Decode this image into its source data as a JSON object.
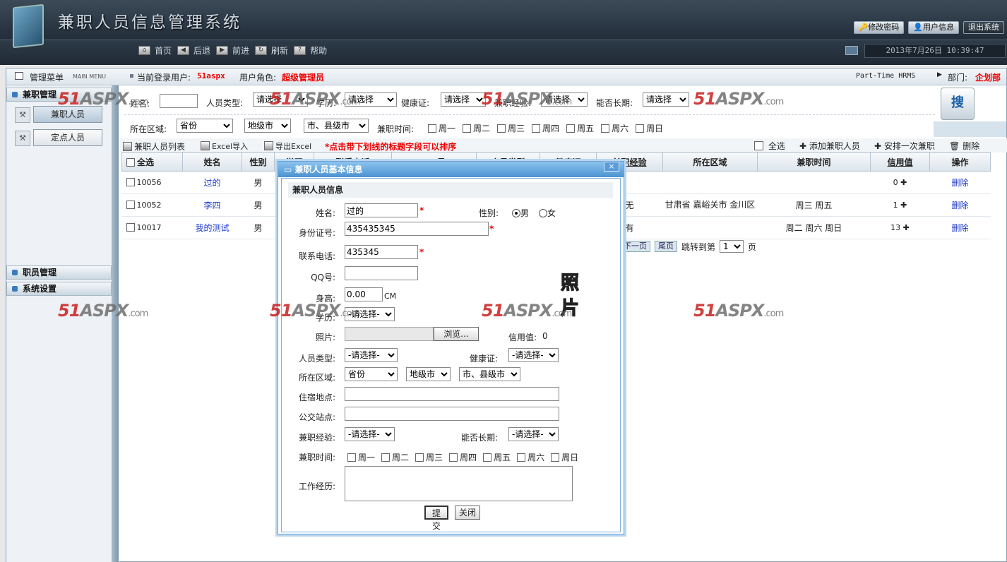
{
  "header": {
    "app_title": "兼职人员信息管理系统",
    "top_tabs": [
      "修改密码",
      "用户信息",
      "退出系统"
    ],
    "nav": [
      "首页",
      "后退",
      "前进",
      "刷新",
      "帮助"
    ],
    "datetime": "2013年7月26日 10:39:47"
  },
  "infobar": {
    "menu_title": "管理菜单",
    "menu_sub": "MAIN MENU",
    "login_label": "当前登录用户:",
    "login_user": "51aspx",
    "role_label": "用户角色:",
    "role": "超级管理员",
    "system_name": "Part-Time HRMS",
    "dept_label": "部门:",
    "dept": "企划部"
  },
  "sidebar": {
    "group1": "兼职管理",
    "items": [
      "兼职人员",
      "定点人员"
    ],
    "group2": "职员管理",
    "group3": "系统设置"
  },
  "search": {
    "name_label": "姓名:",
    "type_label": "人员类型:",
    "type_value": "请选择",
    "edu_label": "学历:",
    "edu_value": "请选择",
    "health_label": "健康证:",
    "health_value": "请选择",
    "exp_label": "兼职经验:",
    "exp_value": "请选择",
    "longterm_label": "能否长期:",
    "longterm_value": "请选择",
    "area_label": "所在区域:",
    "province": "省份",
    "city": "地级市",
    "county": "市、县级市",
    "time_label": "兼职时间:",
    "days": [
      "周一",
      "周二",
      "周三",
      "周四",
      "周五",
      "周六",
      "周日"
    ],
    "search_glyph": "搜"
  },
  "toolbar": {
    "list_tab": "兼职人员列表",
    "excel_import": "Excel导入",
    "excel_export": "导出Excel",
    "sort_hint": "*点击带下划线的标题字段可以排序",
    "select_all": "全选",
    "add": "添加兼职人员",
    "arrange": "安排一次兼职",
    "delete": "删除"
  },
  "table": {
    "headers": [
      "全选",
      "姓名",
      "性别",
      "学历",
      "联系电话",
      "QQ号",
      "人员类型",
      "健康证",
      "兼职经验",
      "所在区域",
      "兼职时间",
      "信用值",
      "操作"
    ],
    "rows": [
      {
        "id": "10056",
        "name": "过的",
        "gender": "男",
        "exp": "",
        "area": "",
        "time": "",
        "credit": "0",
        "op": "删除"
      },
      {
        "id": "10052",
        "name": "李四",
        "gender": "男",
        "exp": "无",
        "area": "甘肃省 嘉峪关市 金川区",
        "time": "周三 周五",
        "credit": "1",
        "op": "删除"
      },
      {
        "id": "10017",
        "name": "我的测试",
        "gender": "男",
        "exp": "有",
        "area": "",
        "time": "周二 周六 周日",
        "credit": "13",
        "op": "删除"
      }
    ]
  },
  "pager": {
    "next": "下一页",
    "last": "尾页",
    "jump_label": "跳转到第",
    "page": "1",
    "page_suffix": "页"
  },
  "watermark": {
    "brand_red": "51",
    "brand_grey": "ASPX",
    "suffix": ".com"
  },
  "dialog": {
    "title": "兼职人员基本信息",
    "close": "×",
    "section": "兼职人员信息",
    "name_label": "姓名:",
    "name_value": "过的",
    "gender_label": "性别:",
    "gender_male": "男",
    "gender_female": "女",
    "id_label": "身份证号:",
    "id_value": "435435345",
    "phone_label": "联系电话:",
    "phone_value": "435345",
    "qq_label": "QQ号:",
    "height_label": "身高:",
    "height_value": "0.00",
    "height_unit": "CM",
    "edu_label": "学历:",
    "select_default": "-请选择-",
    "photo_label": "照片:",
    "browse": "浏览...",
    "credit_label": "信用值:",
    "credit_value": "0",
    "photo_text": "照片",
    "type_label": "人员类型:",
    "health_label": "健康证:",
    "area_label": "所在区域:",
    "province": "省份",
    "city": "地级市",
    "county": "市、县级市",
    "address_label": "住宿地点:",
    "bus_label": "公交站点:",
    "exp_label": "兼职经验:",
    "longterm_label": "能否长期:",
    "time_label": "兼职时间:",
    "days": [
      "周一",
      "周二",
      "周三",
      "周四",
      "周五",
      "周六",
      "周日"
    ],
    "history_label": "工作经历:",
    "submit": "提交",
    "close_btn": "关闭"
  },
  "colors": {
    "accent_red": "#e00000",
    "link_blue": "#1a37c8",
    "dialog_blue": "#4b93d1"
  }
}
